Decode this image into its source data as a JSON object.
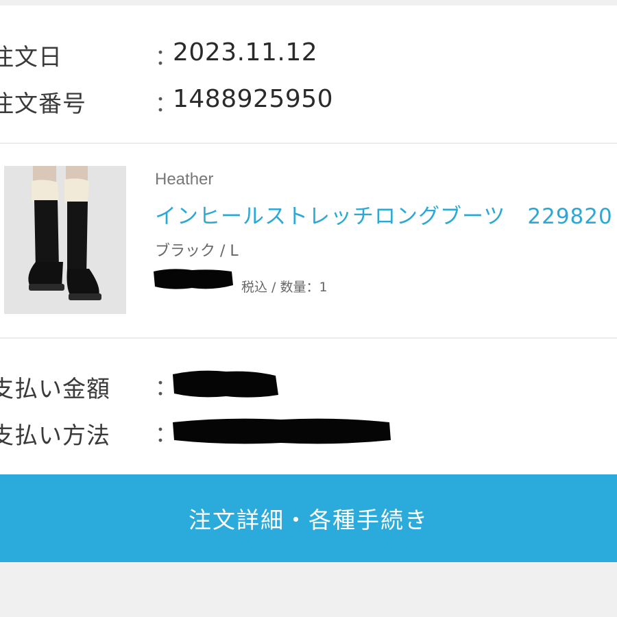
{
  "order": {
    "date_label": "注文日",
    "date_colon": "：",
    "date_value": "2023.11.12",
    "number_label": "注文番号",
    "number_colon": "：",
    "number_value": "1488925950"
  },
  "product": {
    "brand": "Heather",
    "name": "インヒールストレッチロングブーツ　229820",
    "variant": "ブラック / L",
    "price_meta": "税込 / 数量：1"
  },
  "payment": {
    "amount_label": "支払い金額",
    "amount_colon": "：",
    "method_label": "支払い方法",
    "method_colon": "："
  },
  "cta": {
    "label": "注文詳細・各種手続き"
  },
  "colors": {
    "accent": "#2baadc",
    "link": "#2aa8d6"
  }
}
